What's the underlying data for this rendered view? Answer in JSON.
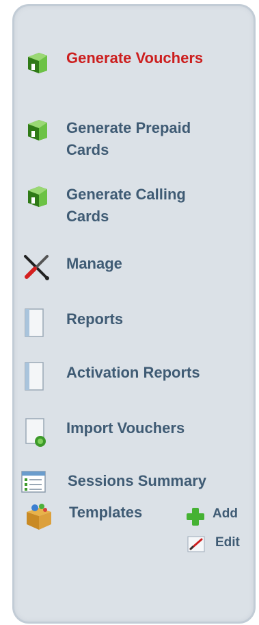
{
  "menu": {
    "items": [
      {
        "id": "generate-vouchers",
        "label_lines": [
          "Generate Vouchers"
        ],
        "icon": "green-book-icon",
        "active": true
      },
      {
        "id": "generate-prepaid-cards",
        "label_lines": [
          "Generate Prepaid",
          "Cards"
        ],
        "icon": "green-book-icon",
        "active": false
      },
      {
        "id": "generate-calling-cards",
        "label_lines": [
          "Generate Calling",
          "Cards"
        ],
        "icon": "green-book-icon",
        "active": false
      },
      {
        "id": "manage",
        "label_lines": [
          "Manage"
        ],
        "icon": "tools-icon",
        "active": false
      },
      {
        "id": "reports",
        "label_lines": [
          "Reports"
        ],
        "icon": "document-icon",
        "active": false
      },
      {
        "id": "activation-reports",
        "label_lines": [
          "Activation Reports"
        ],
        "icon": "document-icon",
        "active": false
      },
      {
        "id": "import-vouchers",
        "label_lines": [
          "Import Vouchers"
        ],
        "icon": "import-document-icon",
        "active": false
      },
      {
        "id": "sessions-summary",
        "label_lines": [
          "Sessions Summary"
        ],
        "icon": "checklist-window-icon",
        "active": false
      },
      {
        "id": "templates",
        "label_lines": [
          "Templates"
        ],
        "icon": "box-icon",
        "active": false
      }
    ],
    "templates_actions": {
      "add_label": "Add",
      "add_icon": "plus-icon",
      "edit_label": "Edit",
      "edit_icon": "pencil-icon"
    }
  },
  "colors": {
    "panel_bg": "#dbe1e7",
    "label": "#3f5b74",
    "active_label": "#cc1f1f"
  }
}
